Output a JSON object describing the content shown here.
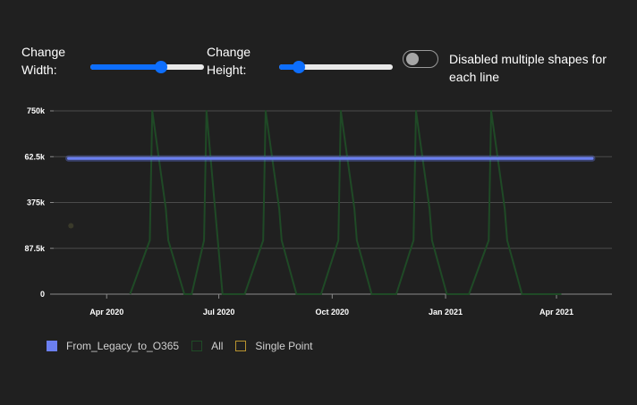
{
  "controls": {
    "width_label": "Change Width:",
    "height_label": "Change Height:",
    "width_value": 0.62,
    "height_value": 0.17,
    "toggle_label": "Disabled multiple shapes for each line",
    "toggle_on": false
  },
  "chart_data": {
    "type": "line",
    "y_tick_labels": [
      "0",
      "87.5k",
      "375k",
      "62.5k",
      "750k"
    ],
    "x_tick_labels": [
      "Apr 2020",
      "Jul 2020",
      "Oct 2020",
      "Jan 2021",
      "Apr 2021"
    ],
    "grid": true,
    "legend_placement": "bottom-left",
    "series": [
      {
        "name": "From_Legacy_to_O365",
        "color": "#6b7ff0",
        "style": "line",
        "x": [
          "2020-03-01",
          "2021-04-30"
        ],
        "y": [
          555000,
          555000
        ]
      },
      {
        "name": "All",
        "color": "#1f4a26",
        "style": "line",
        "x": [
          "2020-04-20",
          "2020-05-06",
          "2020-05-08",
          "2020-05-19",
          "2020-05-21",
          "2020-06-03",
          "2020-06-09",
          "2020-06-19",
          "2020-06-21",
          "2020-07-04",
          "2020-07-22",
          "2020-08-06",
          "2020-08-08",
          "2020-08-19",
          "2020-08-21",
          "2020-09-02",
          "2020-09-22",
          "2020-10-06",
          "2020-10-08",
          "2020-10-19",
          "2020-10-21",
          "2020-11-02",
          "2020-11-22",
          "2020-12-06",
          "2020-12-08",
          "2020-12-19",
          "2020-12-21",
          "2021-01-02",
          "2021-01-20",
          "2021-02-05",
          "2021-02-07",
          "2021-02-18",
          "2021-02-20",
          "2021-03-04",
          "2021-03-24",
          "2021-04-05"
        ],
        "y": [
          0,
          220000,
          750000,
          350000,
          220000,
          0,
          0,
          220000,
          750000,
          0,
          0,
          220000,
          750000,
          350000,
          220000,
          0,
          0,
          220000,
          750000,
          350000,
          220000,
          0,
          0,
          220000,
          750000,
          350000,
          220000,
          0,
          0,
          220000,
          750000,
          350000,
          220000,
          0,
          0,
          0
        ]
      },
      {
        "name": "Single Point",
        "color": "#b8932f",
        "style": "point",
        "x": [
          "2020-03-03"
        ],
        "y": [
          280000
        ]
      }
    ]
  }
}
